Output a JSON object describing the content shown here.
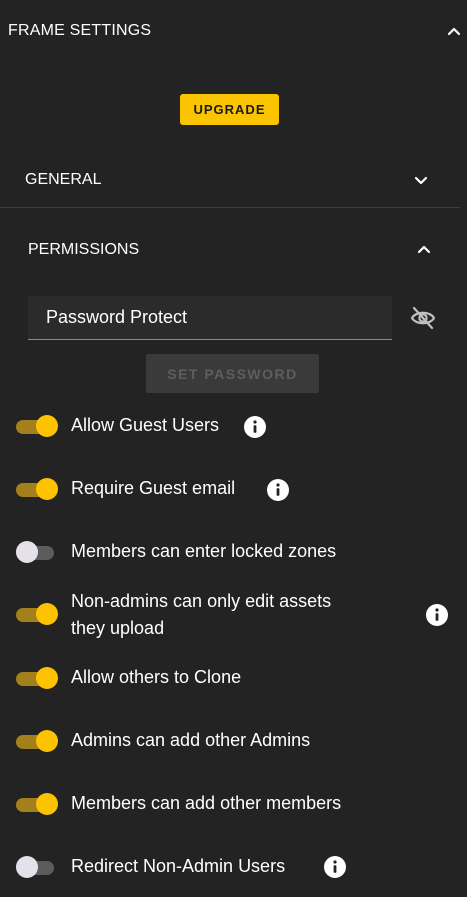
{
  "header": {
    "title": "FRAME SETTINGS"
  },
  "upgrade": {
    "label": "UPGRADE",
    "color": "#fbc400"
  },
  "sections": {
    "general": "GENERAL",
    "permissions": "PERMISSIONS"
  },
  "password": {
    "placeholder": "Password Protect",
    "visibility_icon": "eye-off-icon",
    "set_label": "SET PASSWORD"
  },
  "settings": [
    {
      "label": "Allow Guest Users",
      "enabled": true,
      "info": true
    },
    {
      "label": "Require Guest email",
      "enabled": true,
      "info": true
    },
    {
      "label": "Members can enter locked zones",
      "enabled": false,
      "info": false
    },
    {
      "label_line1": "Non-admins can only edit assets",
      "label_line2": "they upload",
      "enabled": true,
      "info": true
    },
    {
      "label": "Allow others to Clone",
      "enabled": true,
      "info": false
    },
    {
      "label": "Admins can add other Admins",
      "enabled": true,
      "info": false
    },
    {
      "label": "Members can add other members",
      "enabled": true,
      "info": false
    },
    {
      "label": "Redirect Non-Admin Users",
      "enabled": false,
      "info": true
    }
  ],
  "colors": {
    "background": "#232323",
    "accent": "#fdc300",
    "toggle_on_track": "#a4801c",
    "toggle_off_track": "#5c5c5c",
    "toggle_off_knob": "#e4e1ea"
  }
}
